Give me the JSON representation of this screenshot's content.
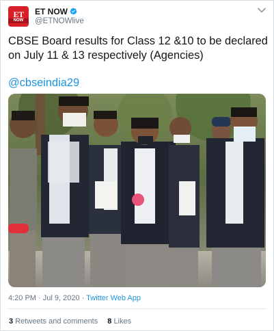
{
  "tweet": {
    "account": {
      "name": "ET NOW",
      "handle": "@ETNOWlive",
      "avatar_text_top": "ET",
      "avatar_text_bottom": "NOW",
      "avatar_color": "#d81e26",
      "verified": true
    },
    "text": "CBSE Board results for Class 12 &10 to be declared on July 11 & 13 respectively (Agencies)",
    "mention": "@cbseindia29",
    "timestamp": "4:20 PM · Jul 9, 2020 · ",
    "source": "Twitter Web App",
    "stats": {
      "retweets_count": "3",
      "retweets_label": "Retweets and comments",
      "likes_count": "8",
      "likes_label": "Likes"
    },
    "photo": {
      "description_icon": "photo-students-wearing-masks"
    }
  },
  "colors": {
    "link": "#1b95e0",
    "muted": "#657786",
    "brand": "#d81e26"
  }
}
